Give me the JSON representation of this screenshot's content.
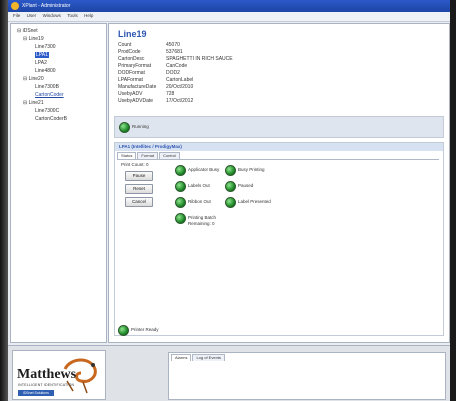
{
  "window": {
    "title": "XPlant - Administrator"
  },
  "menu": [
    "File",
    "User",
    "Windows",
    "Tools",
    "Help"
  ],
  "tree": {
    "root": "iDSnet",
    "nodes": [
      {
        "label": "Line19",
        "children": [
          "Line7300",
          "LPA1",
          "LPA2",
          "Line4800"
        ]
      },
      {
        "label": "Line20",
        "children": [
          "Line7300B",
          "CartonCoder"
        ]
      },
      {
        "label": "Line21",
        "children": [
          "Line7300C",
          "CartonCoderB"
        ]
      }
    ],
    "selected": "LPA1"
  },
  "main": {
    "line_title": "Line19",
    "fields": [
      {
        "k": "Count",
        "v": "45070"
      },
      {
        "k": "ProdCode",
        "v": "537681"
      },
      {
        "k": "CartonDesc",
        "v": "SPAGHETTI IN RICH SAUCE"
      },
      {
        "k": "PrimaryFormat",
        "v": "CanCode"
      },
      {
        "k": "DODFormat",
        "v": "DOD2"
      },
      {
        "k": "LPAFormat",
        "v": "CartonLabel"
      },
      {
        "k": "ManufactureDate",
        "v": "20/Oct/2010"
      },
      {
        "k": "UsebyADV",
        "v": "728"
      },
      {
        "k": "UsebyADVDate",
        "v": "17/Oct/2012"
      }
    ],
    "line_status": "Running"
  },
  "device_panel": {
    "header": "LPA1 (Intellitec / ProdigyMax)",
    "tabs": [
      "Status",
      "Format",
      "Control"
    ],
    "print_count": "Print Count: 0",
    "buttons": {
      "pause": "Pause",
      "reset": "Reset",
      "cancel": "Cancel"
    },
    "indicators": [
      {
        "label": "Applicator Busy"
      },
      {
        "label": "Busy Printing"
      },
      {
        "label": "Labels Out"
      },
      {
        "label": "Paused"
      },
      {
        "label": "Ribbon Out"
      },
      {
        "label": "Label Presented"
      },
      {
        "label": "Printing Batch",
        "sub": "Remaining: 0"
      }
    ],
    "footer_status": "Printer Ready"
  },
  "bottom": {
    "logo_word": "Matthews",
    "logo_sub": "INTELLIGENT IDENTIFICATION",
    "logo_badge": "iDSnet Solutions",
    "event_tabs": [
      "Alarms",
      "Log of Events"
    ]
  }
}
